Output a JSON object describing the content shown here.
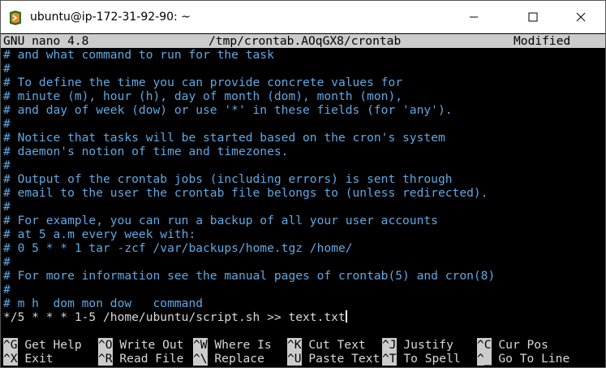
{
  "window": {
    "title": "ubuntu@ip-172-31-92-90: ~"
  },
  "nano_header": {
    "version": "GNU nano 4.8",
    "filename": "/tmp/crontab.AOqGX8/crontab",
    "status": "Modified"
  },
  "editor_lines": [
    "# and what command to run for the task",
    "#",
    "# To define the time you can provide concrete values for",
    "# minute (m), hour (h), day of month (dom), month (mon),",
    "# and day of week (dow) or use '*' in these fields (for 'any').",
    "#",
    "# Notice that tasks will be started based on the cron's system",
    "# daemon's notion of time and timezones.",
    "#",
    "# Output of the crontab jobs (including errors) is sent through",
    "# email to the user the crontab file belongs to (unless redirected).",
    "#",
    "# For example, you can run a backup of all your user accounts",
    "# at 5 a.m every week with:",
    "# 0 5 * * 1 tar -zcf /var/backups/home.tgz /home/",
    "#",
    "# For more information see the manual pages of crontab(5) and cron(8)",
    "#",
    "# m h  dom mon dow   command",
    "*/5 * * * 1-5 /home/ubuntu/script.sh >> text.txt"
  ],
  "shortcuts_row1": [
    {
      "key": "^G",
      "label": "Get Help"
    },
    {
      "key": "^O",
      "label": "Write Out"
    },
    {
      "key": "^W",
      "label": "Where Is"
    },
    {
      "key": "^K",
      "label": "Cut Text"
    },
    {
      "key": "^J",
      "label": "Justify"
    },
    {
      "key": "^C",
      "label": "Cur Pos"
    }
  ],
  "shortcuts_row2": [
    {
      "key": "^X",
      "label": "Exit"
    },
    {
      "key": "^R",
      "label": "Read File"
    },
    {
      "key": "^\\",
      "label": "Replace"
    },
    {
      "key": "^U",
      "label": "Paste Text"
    },
    {
      "key": "^T",
      "label": "To Spell"
    },
    {
      "key": "^_",
      "label": "Go To Line"
    }
  ]
}
